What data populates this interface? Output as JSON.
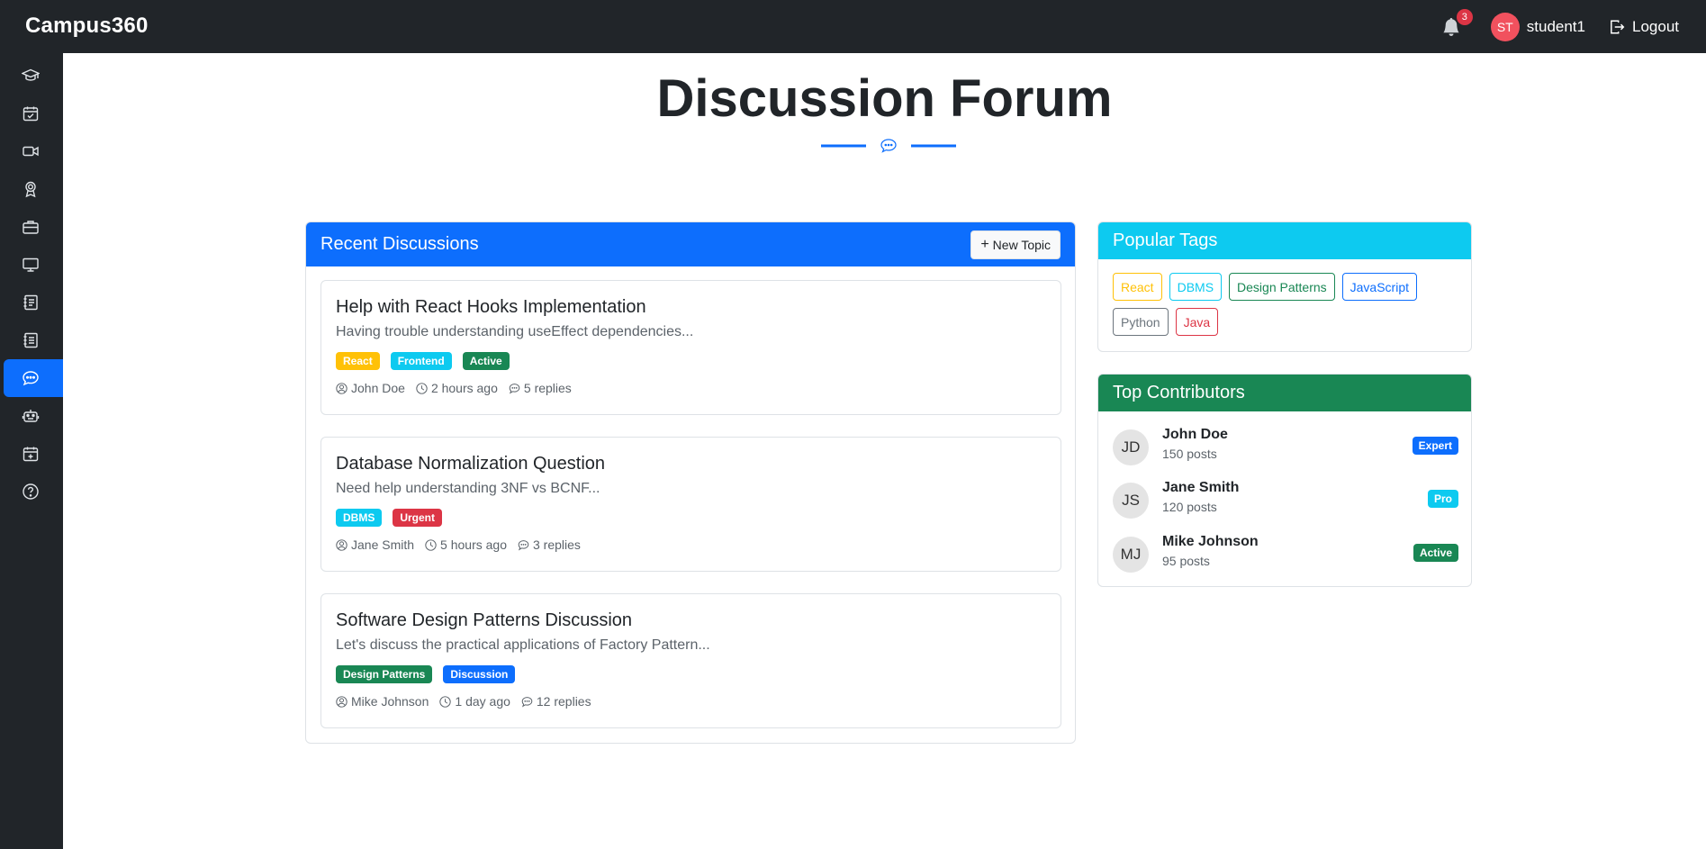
{
  "app": {
    "brand": "Campus360"
  },
  "navbar": {
    "notification_count": "3",
    "user_initials": "ST",
    "username": "student1",
    "logout_label": "Logout"
  },
  "sidebar": {
    "items": [
      {
        "icon": "graduation-cap-icon",
        "active": false
      },
      {
        "icon": "calendar-check-icon",
        "active": false
      },
      {
        "icon": "video-camera-icon",
        "active": false
      },
      {
        "icon": "award-icon",
        "active": false
      },
      {
        "icon": "briefcase-icon",
        "active": false
      },
      {
        "icon": "monitor-icon",
        "active": false
      },
      {
        "icon": "journal-text-icon",
        "active": false
      },
      {
        "icon": "journal-list-icon",
        "active": false
      },
      {
        "icon": "chat-dots-icon",
        "active": true
      },
      {
        "icon": "robot-icon",
        "active": false
      },
      {
        "icon": "calendar-plus-icon",
        "active": false
      },
      {
        "icon": "question-circle-icon",
        "active": false
      }
    ]
  },
  "page": {
    "title": "Discussion Forum"
  },
  "recent": {
    "header": "Recent Discussions",
    "new_topic_label": "New Topic",
    "discussions": [
      {
        "title": "Help with React Hooks Implementation",
        "description": "Having trouble understanding useEffect dependencies...",
        "tags": [
          {
            "label": "React",
            "color": "#ffc107"
          },
          {
            "label": "Frontend",
            "color": "#0dcaf0"
          },
          {
            "label": "Active",
            "color": "#198754"
          }
        ],
        "author": "John Doe",
        "time": "2 hours ago",
        "replies": "5 replies"
      },
      {
        "title": "Database Normalization Question",
        "description": "Need help understanding 3NF vs BCNF...",
        "tags": [
          {
            "label": "DBMS",
            "color": "#0dcaf0"
          },
          {
            "label": "Urgent",
            "color": "#dc3545"
          }
        ],
        "author": "Jane Smith",
        "time": "5 hours ago",
        "replies": "3 replies"
      },
      {
        "title": "Software Design Patterns Discussion",
        "description": "Let's discuss the practical applications of Factory Pattern...",
        "tags": [
          {
            "label": "Design Patterns",
            "color": "#198754"
          },
          {
            "label": "Discussion",
            "color": "#0d6efd"
          }
        ],
        "author": "Mike Johnson",
        "time": "1 day ago",
        "replies": "12 replies"
      }
    ]
  },
  "popular_tags": {
    "header": "Popular Tags",
    "tags": [
      {
        "label": "React",
        "color": "#ffc107"
      },
      {
        "label": "DBMS",
        "color": "#0dcaf0"
      },
      {
        "label": "Design Patterns",
        "color": "#198754"
      },
      {
        "label": "JavaScript",
        "color": "#0d6efd"
      },
      {
        "label": "Python",
        "color": "#6c757d"
      },
      {
        "label": "Java",
        "color": "#dc3545"
      }
    ]
  },
  "contributors": {
    "header": "Top Contributors",
    "people": [
      {
        "initials": "JD",
        "name": "John Doe",
        "posts": "150 posts",
        "badge": "Expert",
        "badge_color": "#0d6efd"
      },
      {
        "initials": "JS",
        "name": "Jane Smith",
        "posts": "120 posts",
        "badge": "Pro",
        "badge_color": "#0dcaf0"
      },
      {
        "initials": "MJ",
        "name": "Mike Johnson",
        "posts": "95 posts",
        "badge": "Active",
        "badge_color": "#198754"
      }
    ]
  },
  "colors": {
    "navbar_bg": "#212529",
    "primary": "#0d6efd",
    "info": "#0dcaf0",
    "success": "#198754"
  }
}
